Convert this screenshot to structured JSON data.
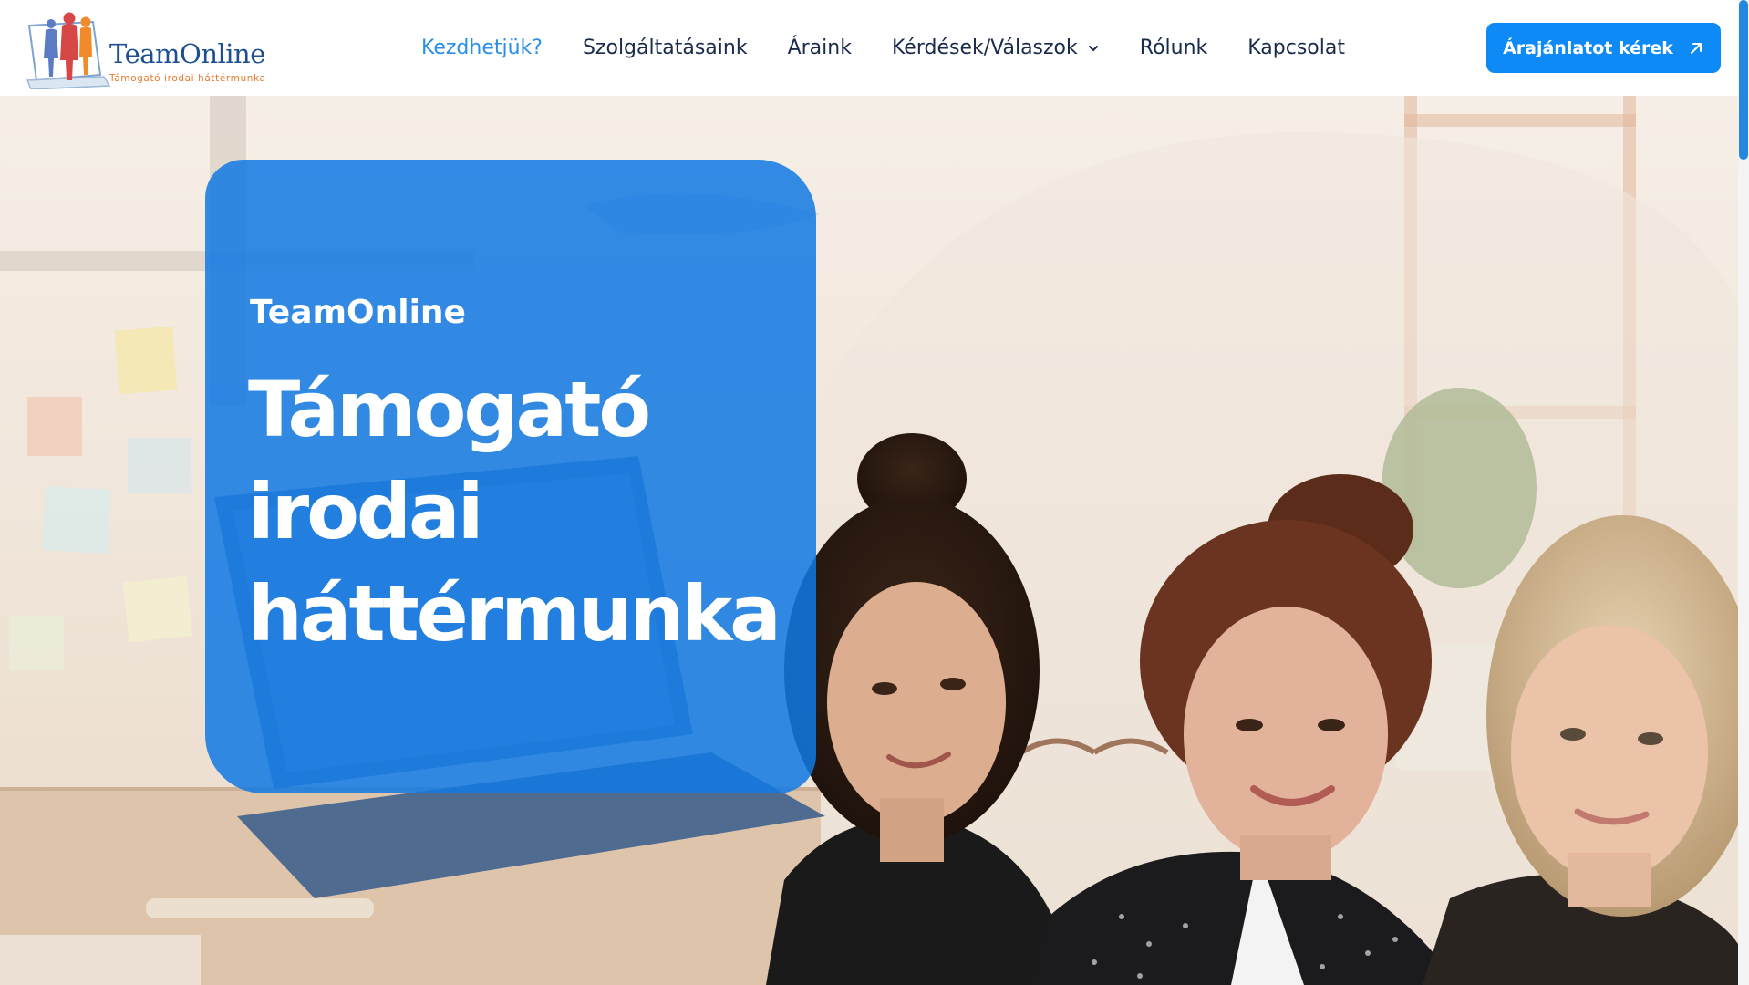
{
  "header": {
    "logo": {
      "name": "TeamOnline",
      "tagline": "Támogató irodai háttérmunka"
    },
    "nav": [
      {
        "label": "Kezdhetjük?",
        "active": true
      },
      {
        "label": "Szolgáltatásaink"
      },
      {
        "label": "Áraink"
      },
      {
        "label": "Kérdések/Válaszok",
        "has_dropdown": true,
        "icon": "chevron-down-icon"
      },
      {
        "label": "Rólunk"
      },
      {
        "label": "Kapcsolat"
      }
    ],
    "cta": {
      "label": "Árajánlatot kérek",
      "icon": "arrow-up-right-icon"
    }
  },
  "hero": {
    "kicker": "TeamOnline",
    "title_lines": [
      "Támogató",
      "irodai",
      "háttérmunka"
    ]
  },
  "colors": {
    "accent": "#0d8af5",
    "nav_active": "#2a8fe6",
    "nav_text": "#1a2b4c",
    "card": "#1179e3",
    "logo_text": "#1d4f91",
    "logo_tagline": "#e47a2c"
  }
}
